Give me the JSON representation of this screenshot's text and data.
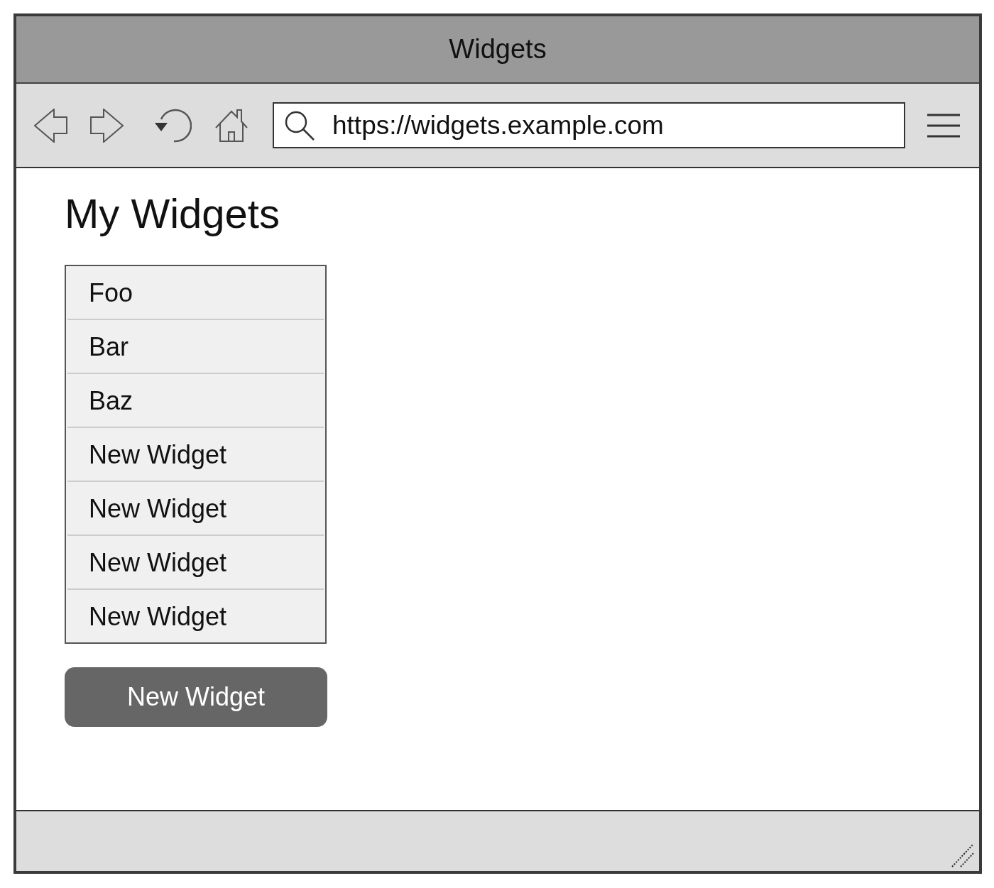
{
  "window": {
    "title": "Widgets"
  },
  "toolbar": {
    "address": {
      "value": "https://widgets.example.com"
    }
  },
  "page": {
    "heading": "My Widgets",
    "widgets": [
      {
        "label": "Foo"
      },
      {
        "label": "Bar"
      },
      {
        "label": "Baz"
      },
      {
        "label": "New Widget"
      },
      {
        "label": "New Widget"
      },
      {
        "label": "New Widget"
      },
      {
        "label": "New Widget"
      }
    ],
    "new_widget_button": {
      "label": "New Widget"
    }
  }
}
